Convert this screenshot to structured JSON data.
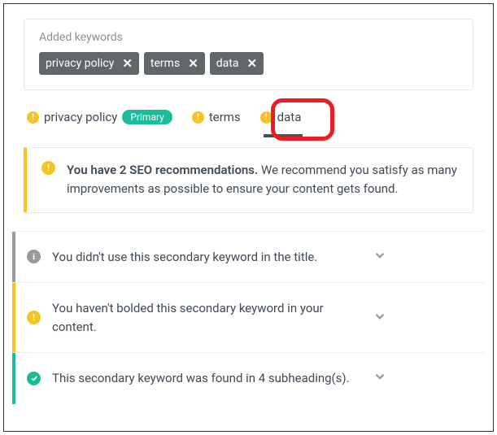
{
  "added": {
    "label": "Added keywords",
    "chips": [
      "privacy policy",
      "terms",
      "data"
    ]
  },
  "tabs": [
    {
      "label": "privacy policy",
      "status": "yellow",
      "badge": "Primary",
      "active": false
    },
    {
      "label": "terms",
      "status": "yellow",
      "active": false
    },
    {
      "label": "data",
      "status": "yellow",
      "active": true
    }
  ],
  "recommendation": {
    "bold": "You have 2 SEO recommendations.",
    "rest": " We recommend you satisfy as many improvements as possible to ensure your content gets found."
  },
  "items": [
    {
      "status": "gray",
      "text": "You didn't use this secondary keyword in the title."
    },
    {
      "status": "yellow",
      "text": "You haven't bolded this secondary keyword in your content."
    },
    {
      "status": "green",
      "text": "This secondary keyword was found in 4 subheading(s)."
    }
  ]
}
